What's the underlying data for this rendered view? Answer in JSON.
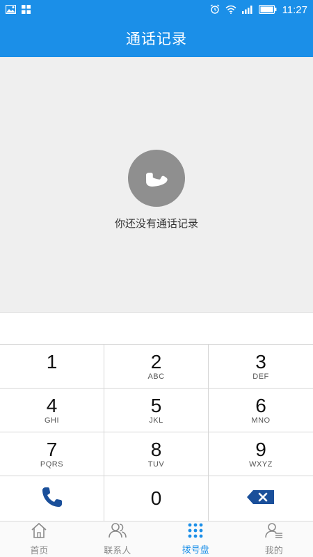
{
  "status_bar": {
    "time": "11:27",
    "icons": [
      "gallery-icon",
      "app-grid-icon",
      "alarm-icon",
      "wifi-icon",
      "signal-icon",
      "battery-icon"
    ]
  },
  "header": {
    "title": "通话记录"
  },
  "empty_state": {
    "message": "你还没有通话记录",
    "icon": "phone-handset-icon"
  },
  "keypad": {
    "keys": [
      {
        "digit": "1",
        "letters": ""
      },
      {
        "digit": "2",
        "letters": "ABC"
      },
      {
        "digit": "3",
        "letters": "DEF"
      },
      {
        "digit": "4",
        "letters": "GHI"
      },
      {
        "digit": "5",
        "letters": "JKL"
      },
      {
        "digit": "6",
        "letters": "MNO"
      },
      {
        "digit": "7",
        "letters": "PQRS"
      },
      {
        "digit": "8",
        "letters": "TUV"
      },
      {
        "digit": "9",
        "letters": "WXYZ"
      }
    ],
    "zero": "0",
    "call_icon": "phone-call-icon",
    "backspace_icon": "backspace-icon"
  },
  "bottom_nav": {
    "items": [
      {
        "label": "首页",
        "icon": "home-icon",
        "active": false
      },
      {
        "label": "联系人",
        "icon": "contacts-icon",
        "active": false
      },
      {
        "label": "拨号盘",
        "icon": "dialpad-icon",
        "active": true
      },
      {
        "label": "我的",
        "icon": "profile-icon",
        "active": false
      }
    ]
  },
  "colors": {
    "primary": "#1b8fe8",
    "dark_blue": "#1a4f9a",
    "empty_bg": "#efefef"
  }
}
